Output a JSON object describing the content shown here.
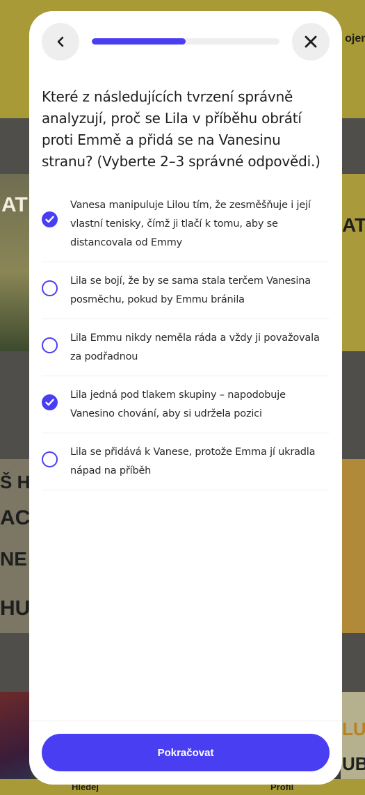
{
  "background": {
    "top_label": "ojen",
    "nav": {
      "search_label": "Hledej",
      "profile_label": "Profil"
    }
  },
  "quiz": {
    "progress": 0.5,
    "question": "Které z následujících tvrzení správně analyzují, proč se Lila v příběhu obrátí proti Emmě a přidá se na Vanesinu stranu? (Vyberte 2–3 správné odpovědi.)",
    "options": [
      {
        "label": "Vanesa manipuluje Lilou tím, že zesměšňuje i její vlastní tenisky, čímž ji tlačí k tomu, aby se distancovala od Emmy",
        "selected": true
      },
      {
        "label": "Lila se bojí, že by se sama stala terčem Vanesina posměchu, pokud by Emmu bránila",
        "selected": false
      },
      {
        "label": "Lila Emmu nikdy neměla ráda a vždy ji považovala za podřadnou",
        "selected": false
      },
      {
        "label": "Lila jedná pod tlakem skupiny – napodobuje Vanesino chování, aby si udržela pozici",
        "selected": true
      },
      {
        "label": "Lila se přidává k Vanese, protože Emma jí ukradla nápad na příběh",
        "selected": false
      }
    ],
    "continue_label": "Pokračovat"
  },
  "icons": {
    "back": "chevron-left-icon",
    "close": "close-icon",
    "checked": "check-icon"
  },
  "colors": {
    "accent": "#4a3ef2",
    "overlay_yellow": "#a89a36"
  }
}
